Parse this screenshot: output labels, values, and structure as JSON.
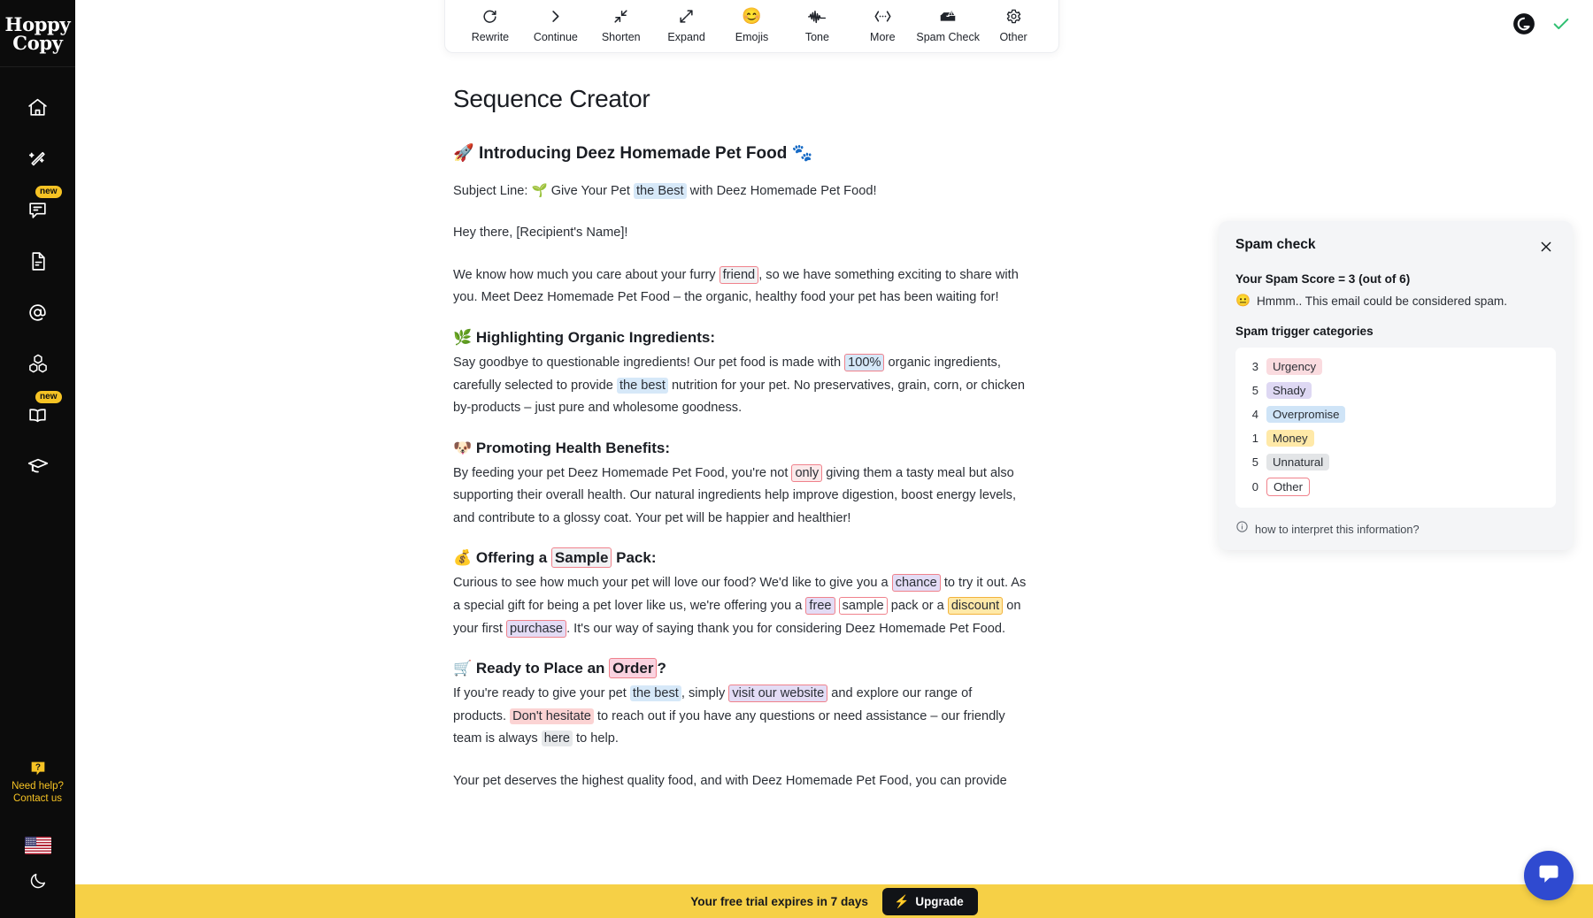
{
  "brand": {
    "name_line1": "Hoppy",
    "name_line2": "Copy"
  },
  "sidebar": {
    "items": [
      {
        "name": "home",
        "icon": "home-icon",
        "badge": ""
      },
      {
        "name": "magic-wand",
        "icon": "magic-wand-icon",
        "badge": ""
      },
      {
        "name": "chat",
        "icon": "chat-bubble-icon",
        "badge": "new"
      },
      {
        "name": "document",
        "icon": "document-icon",
        "badge": ""
      },
      {
        "name": "email",
        "icon": "at-sign-icon",
        "badge": ""
      },
      {
        "name": "templates",
        "icon": "blocks-icon",
        "badge": ""
      },
      {
        "name": "library",
        "icon": "open-book-icon",
        "badge": "new"
      },
      {
        "name": "academy",
        "icon": "graduation-cap-icon",
        "badge": ""
      }
    ],
    "help": {
      "icon": "question-bubble-icon",
      "line1": "Need help?",
      "line2": "Contact us"
    },
    "language_flag": "us-flag-icon",
    "theme_toggle": "moon-icon"
  },
  "toolbar": {
    "items": [
      {
        "label": "Rewrite",
        "icon": "refresh-icon",
        "glyph": ""
      },
      {
        "label": "Continue",
        "icon": "chevron-right-icon",
        "glyph": ""
      },
      {
        "label": "Shorten",
        "icon": "shrink-arrows-icon",
        "glyph": ""
      },
      {
        "label": "Expand",
        "icon": "expand-arrows-icon",
        "glyph": ""
      },
      {
        "label": "Emojis",
        "icon": "smiley-emoji-icon",
        "glyph": "😊"
      },
      {
        "label": "Tone",
        "icon": "waveform-icon",
        "glyph": ""
      },
      {
        "label": "More",
        "icon": "ellipsis-brackets-icon",
        "glyph": ""
      },
      {
        "label": "Spam Check",
        "icon": "spam-inbox-icon",
        "glyph": ""
      },
      {
        "label": "Other",
        "icon": "gear-icon",
        "glyph": ""
      }
    ]
  },
  "status_icons": {
    "grammarly": "grammarly-icon",
    "check": "green-check-icon"
  },
  "document": {
    "title": "Sequence Creator",
    "headline_emoji_left": "🚀",
    "headline": "Introducing Deez Homemade Pet Food",
    "headline_emoji_right": "🐾",
    "subject_label": "Subject Line:",
    "subject_emoji": "🌱",
    "subject_pre": "Give Your Pet ",
    "subject_hl": "the Best",
    "subject_post": " with Deez Homemade Pet Food!",
    "greeting": "Hey there, [Recipient's Name]!",
    "p1_a": "We know how much you care about your furry ",
    "p1_hl": "friend",
    "p1_b": ", so we have something exciting to share with you. Meet Deez Homemade Pet Food – the organic, healthy food your pet has been waiting for!",
    "s1_emoji": "🌿",
    "s1_heading": "Highlighting Organic Ingredients:",
    "s1_a": "Say goodbye to questionable ingredients! Our pet food is made with ",
    "s1_hl1": "100%",
    "s1_b": " organic ingredients, carefully selected to provide ",
    "s1_hl2": "the best",
    "s1_c": " nutrition for your pet. No preservatives, grain, corn, or chicken by-products – just pure and wholesome goodness.",
    "s2_emoji": "🐶",
    "s2_heading": "Promoting Health Benefits:",
    "s2_a": "By feeding your pet Deez Homemade Pet Food, you're not ",
    "s2_hl": "only",
    "s2_b": " giving them a tasty meal but also supporting their overall health. Our natural ingredients help improve digestion, boost energy levels, and contribute to a glossy coat. Your pet will be happier and healthier!",
    "s3_emoji": "💰",
    "s3_h_a": "Offering a ",
    "s3_h_hl": "Sample",
    "s3_h_b": " Pack:",
    "s3_a": "Curious to see how much your pet will love our food? We'd like to give you a ",
    "s3_hl1": "chance",
    "s3_b": " to try it out. As a special gift for being a pet lover like us, we're offering you a ",
    "s3_hl2": "free",
    "s3_c": " ",
    "s3_hl3": "sample",
    "s3_d": " pack or a ",
    "s3_hl4": "discount",
    "s3_e": " on your first ",
    "s3_hl5": "purchase",
    "s3_f": ". It's our way of saying thank you for considering Deez Homemade Pet Food.",
    "s4_emoji": "🛒",
    "s4_h_a": "Ready to Place an ",
    "s4_h_hl": "Order",
    "s4_h_b": "?",
    "s4_a": "If you're ready to give your pet ",
    "s4_hl1": "the best",
    "s4_b": ", simply ",
    "s4_hl2": "visit our website",
    "s4_c": " and explore our range of products. ",
    "s4_hl3": "Don't hesitate",
    "s4_d": " to reach out if you have any questions or need assistance – our friendly team is always ",
    "s4_hl4": "here",
    "s4_e": " to help.",
    "p_last": "Your pet deserves the highest quality food, and with Deez Homemade Pet Food, you can provide"
  },
  "spam_panel": {
    "title": "Spam check",
    "close_icon": "close-icon",
    "score_text": "Your Spam Score = 3 (out of 6)",
    "verdict_emoji": "😐",
    "verdict_text": "Hmmm.. This email could be considered spam.",
    "subtitle": "Spam trigger categories",
    "categories": [
      {
        "count": "3",
        "label": "Urgency",
        "bg": "#fadbdf",
        "color": "#2b2f36",
        "border": "none"
      },
      {
        "count": "5",
        "label": "Shady",
        "bg": "#ded8f3",
        "color": "#2b2f36",
        "border": "none"
      },
      {
        "count": "4",
        "label": "Overpromise",
        "bg": "#cfe4f7",
        "color": "#2b2f36",
        "border": "none"
      },
      {
        "count": "1",
        "label": "Money",
        "bg": "#ffe9a8",
        "color": "#2b2f36",
        "border": "none"
      },
      {
        "count": "5",
        "label": "Unnatural",
        "bg": "#e3e5e7",
        "color": "#2b2f36",
        "border": "none"
      },
      {
        "count": "0",
        "label": "Other",
        "bg": "#ffffff",
        "color": "#2b2f36",
        "border": "1px solid #f0828c"
      }
    ],
    "footer_icon": "info-icon",
    "footer_text": "how to interpret this information?"
  },
  "trial_bar": {
    "text": "Your free trial expires in 7 days",
    "button_label": "Upgrade",
    "button_icon": "bolt-icon",
    "bg_color": "#f6d046"
  },
  "chat_widget": {
    "icon": "chat-widget-icon",
    "color": "#2f4ad0"
  }
}
